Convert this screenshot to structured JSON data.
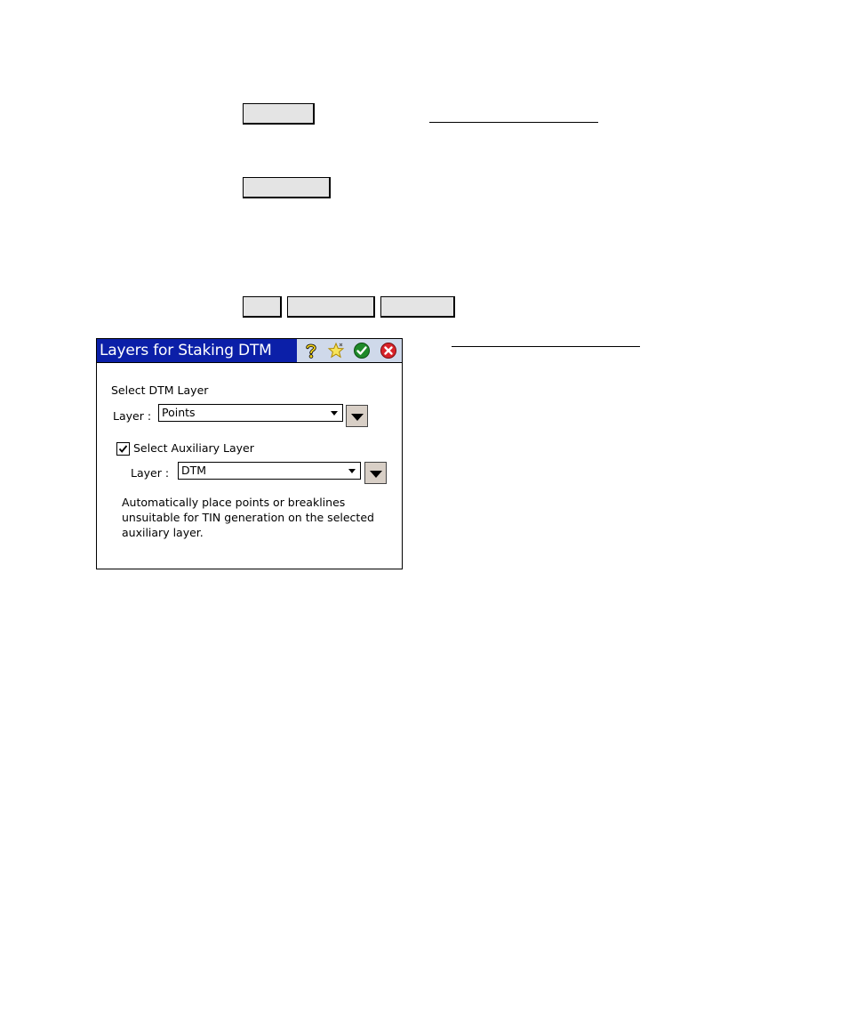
{
  "page": {
    "buttons_row1": [
      ""
    ],
    "buttons_row2": [
      ""
    ],
    "buttons_row3": [
      "",
      "",
      ""
    ]
  },
  "dialog": {
    "title": "Layers for Staking DTM",
    "icons": [
      "help-icon",
      "favorite-star-icon",
      "ok-check-icon",
      "close-icon"
    ],
    "section_label": "Select DTM Layer",
    "layer_label": "Layer :",
    "layer_value": "Points",
    "aux_checkbox_label": "Select Auxiliary Layer",
    "aux_checked": true,
    "aux_layer_label": "Layer :",
    "aux_layer_value": "DTM",
    "description": "Automatically place points or breaklines unsuitable for TIN generation on the selected auxiliary layer."
  },
  "colors": {
    "titlebar_bg": "#0b1fa8",
    "titlebar_icons_bg": "#cfd9ea",
    "button_bg": "#e4e4e4",
    "dropdown_button_bg": "#d8cfc6"
  }
}
